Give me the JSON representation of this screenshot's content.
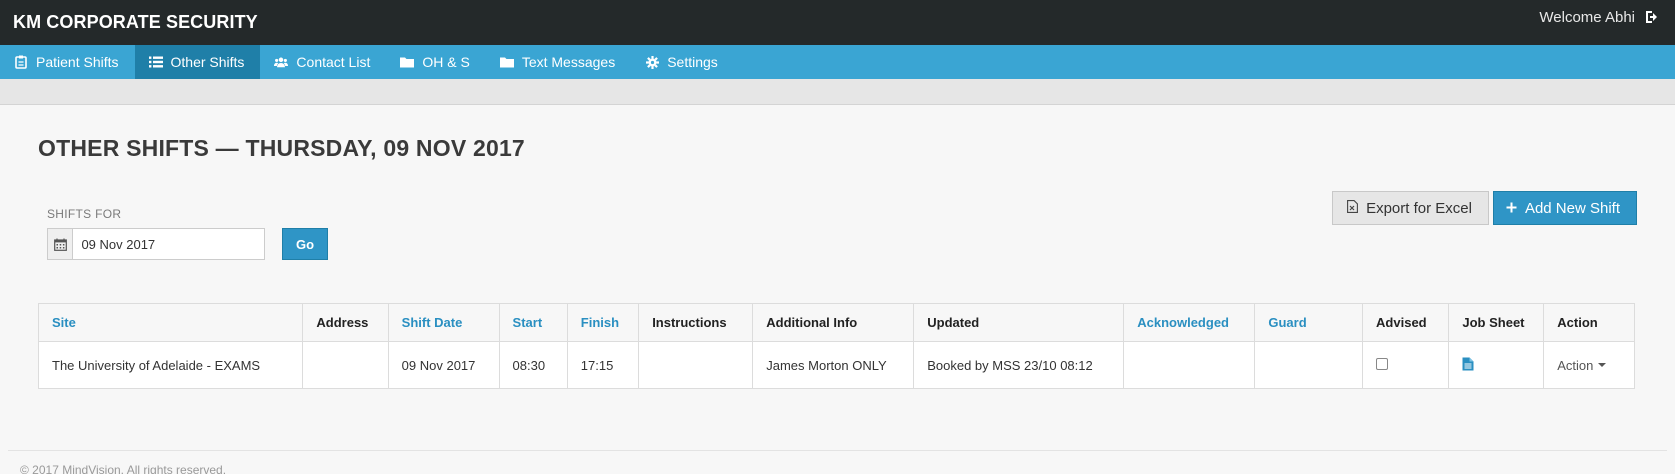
{
  "app": {
    "brand": "KM CORPORATE SECURITY",
    "welcome": "Welcome Abhi"
  },
  "nav": [
    {
      "label": "Patient Shifts",
      "icon": "clipboard-icon",
      "active": false
    },
    {
      "label": "Other Shifts",
      "icon": "list-icon",
      "active": true
    },
    {
      "label": "Contact List",
      "icon": "users-icon",
      "active": false
    },
    {
      "label": "OH & S",
      "icon": "folder-icon",
      "active": false
    },
    {
      "label": "Text Messages",
      "icon": "folder-icon",
      "active": false
    },
    {
      "label": "Settings",
      "icon": "gear-icon",
      "active": false
    }
  ],
  "page": {
    "title": "OTHER SHIFTS — THURSDAY, 09 NOV 2017"
  },
  "filter": {
    "label": "SHIFTS FOR",
    "date_value": "09 Nov 2017",
    "go_label": "Go"
  },
  "actions": {
    "export_label": "Export for Excel",
    "add_label": "Add New Shift"
  },
  "table": {
    "columns": [
      "Site",
      "Address",
      "Shift Date",
      "Start",
      "Finish",
      "Instructions",
      "Additional Info",
      "Updated",
      "Acknowledged",
      "Guard",
      "Advised",
      "Job Sheet",
      "Action"
    ],
    "rows": [
      {
        "site": "The University of Adelaide - EXAMS",
        "address": "",
        "shift_date": "09 Nov 2017",
        "start": "08:30",
        "finish": "17:15",
        "instructions": "",
        "additional_info": "James Morton ONLY",
        "updated": "Booked by MSS 23/10 08:12",
        "acknowledged": "",
        "guard": "",
        "advised": false,
        "action_label": "Action"
      }
    ]
  },
  "footer": {
    "text": "© 2017 MindVision. All rights reserved."
  },
  "colors": {
    "topbar": "#24292a",
    "nav": "#3aa5d3",
    "nav_active": "#1f7fa8",
    "primary": "#2f95c6",
    "link": "#2a8fc1"
  }
}
